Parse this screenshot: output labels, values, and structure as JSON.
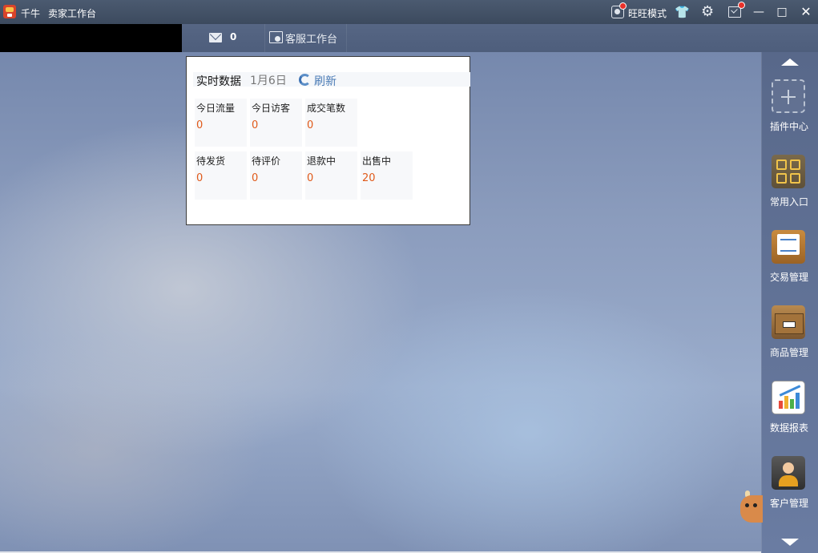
{
  "titlebar": {
    "app_name": "千牛",
    "window_title": "卖家工作台",
    "wangwang_mode": "旺旺模式"
  },
  "toolbar": {
    "mail_count": "0",
    "service_workbench": "客服工作台"
  },
  "realtime": {
    "title": "实时数据",
    "date": "1月6日",
    "refresh": "刷新",
    "row1": [
      {
        "label": "今日流量",
        "value": "0"
      },
      {
        "label": "今日访客",
        "value": "0"
      },
      {
        "label": "成交笔数",
        "value": "0"
      }
    ],
    "row2": [
      {
        "label": "待发货",
        "value": "0"
      },
      {
        "label": "待评价",
        "value": "0"
      },
      {
        "label": "退款中",
        "value": "0"
      },
      {
        "label": "出售中",
        "value": "20"
      }
    ]
  },
  "sidebar": {
    "items": [
      {
        "label": "插件中心",
        "icon": "plus-icon"
      },
      {
        "label": "常用入口",
        "icon": "grid-icon"
      },
      {
        "label": "交易管理",
        "icon": "document-icon"
      },
      {
        "label": "商品管理",
        "icon": "box-icon"
      },
      {
        "label": "数据报表",
        "icon": "chart-icon"
      },
      {
        "label": "客户管理",
        "icon": "people-icon"
      }
    ]
  },
  "colors": {
    "titlebar": "#3c4a5e",
    "accent_orange": "#e05a1a",
    "refresh_blue": "#4a7bb5",
    "notification_red": "#e8312a"
  }
}
